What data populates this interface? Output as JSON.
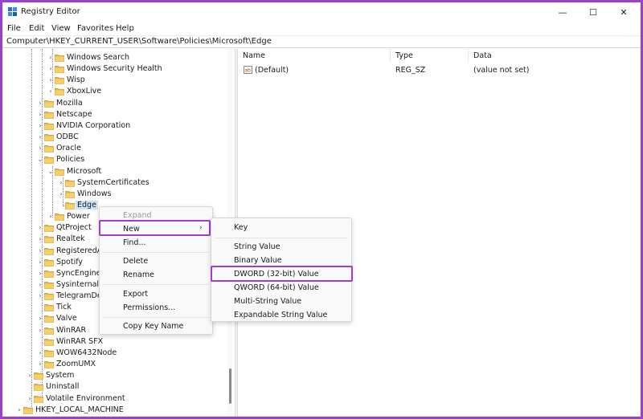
{
  "window": {
    "title": "Registry Editor",
    "min_glyph": "—",
    "max_glyph": "☐",
    "close_glyph": "✕"
  },
  "menu": [
    "File",
    "Edit",
    "View",
    "Favorites",
    "Help"
  ],
  "address": "Computer\\HKEY_CURRENT_USER\\Software\\Policies\\Microsoft\\Edge",
  "tree": [
    {
      "label": "Windows Search",
      "level": 3,
      "chevron": "›"
    },
    {
      "label": "Windows Security Health",
      "level": 3,
      "chevron": "›"
    },
    {
      "label": "Wisp",
      "level": 3,
      "chevron": "›"
    },
    {
      "label": "XboxLive",
      "level": 3,
      "chevron": "›"
    },
    {
      "label": "Mozilla",
      "level": 2,
      "chevron": "›"
    },
    {
      "label": "Netscape",
      "level": 2,
      "chevron": "›"
    },
    {
      "label": "NVIDIA Corporation",
      "level": 2,
      "chevron": "›"
    },
    {
      "label": "ODBC",
      "level": 2,
      "chevron": "›"
    },
    {
      "label": "Oracle",
      "level": 2,
      "chevron": "›"
    },
    {
      "label": "Policies",
      "level": 2,
      "chevron": "⌄"
    },
    {
      "label": "Microsoft",
      "level": 3,
      "chevron": "⌄"
    },
    {
      "label": "SystemCertificates",
      "level": 4,
      "chevron": "›"
    },
    {
      "label": "Windows",
      "level": 4,
      "chevron": "›"
    },
    {
      "label": "Edge",
      "level": 4,
      "chevron": "",
      "selected": true
    },
    {
      "label": "Power",
      "level": 3,
      "chevron": "›"
    },
    {
      "label": "QtProject",
      "level": 2,
      "chevron": "›"
    },
    {
      "label": "Realtek",
      "level": 2,
      "chevron": "›"
    },
    {
      "label": "RegisteredA",
      "level": 2,
      "chevron": "›"
    },
    {
      "label": "Spotify",
      "level": 2,
      "chevron": "›"
    },
    {
      "label": "SyncEngines",
      "level": 2,
      "chevron": "›"
    },
    {
      "label": "Sysinternals",
      "level": 2,
      "chevron": "›"
    },
    {
      "label": "TelegramDe",
      "level": 2,
      "chevron": "›"
    },
    {
      "label": "Tick",
      "level": 2,
      "chevron": ""
    },
    {
      "label": "Valve",
      "level": 2,
      "chevron": "›"
    },
    {
      "label": "WinRAR",
      "level": 2,
      "chevron": "›"
    },
    {
      "label": "WinRAR SFX",
      "level": 2,
      "chevron": ""
    },
    {
      "label": "WOW6432Node",
      "level": 2,
      "chevron": "›"
    },
    {
      "label": "ZoomUMX",
      "level": 2,
      "chevron": "›"
    },
    {
      "label": "System",
      "level": 1,
      "chevron": "›"
    },
    {
      "label": "Uninstall",
      "level": 1,
      "chevron": ""
    },
    {
      "label": "Volatile Environment",
      "level": 1,
      "chevron": "›"
    },
    {
      "label": "HKEY_LOCAL_MACHINE",
      "level": 0,
      "chevron": "›"
    }
  ],
  "list": {
    "columns": [
      "Name",
      "Type",
      "Data"
    ],
    "rows": [
      {
        "name": "(Default)",
        "type": "REG_SZ",
        "data": "(value not set)"
      }
    ]
  },
  "context_menu": {
    "items": [
      {
        "label": "Expand",
        "disabled": true
      },
      {
        "label": "New",
        "submenu": true,
        "submenu_glyph": "›"
      },
      {
        "label": "Find..."
      },
      {
        "label": "Delete"
      },
      {
        "label": "Rename"
      },
      {
        "label": "Export"
      },
      {
        "label": "Permissions..."
      },
      {
        "label": "Copy Key Name"
      }
    ]
  },
  "submenu": {
    "items": [
      {
        "label": "Key"
      },
      {
        "label": "String Value"
      },
      {
        "label": "Binary Value"
      },
      {
        "label": "DWORD (32-bit) Value"
      },
      {
        "label": "QWORD (64-bit) Value"
      },
      {
        "label": "Multi-String Value"
      },
      {
        "label": "Expandable String Value"
      }
    ]
  },
  "colors": {
    "frame": "#9b3fd0",
    "highlight_box": "#a23ad6",
    "selection": "#cce4f7",
    "folder": "#e8b84a"
  }
}
